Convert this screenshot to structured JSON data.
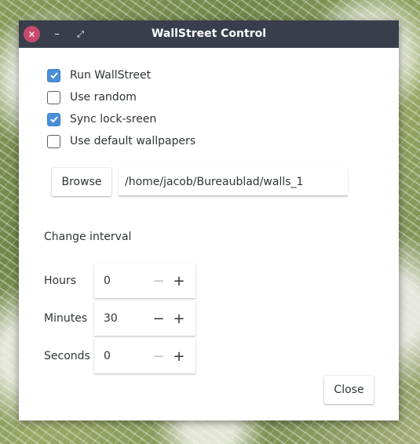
{
  "window": {
    "title": "WallStreet Control",
    "controls": {
      "close_glyph": "✕",
      "minimize_glyph": "–",
      "maximize_glyph": "⤢"
    }
  },
  "options": [
    {
      "label": "Run WallStreet",
      "checked": true
    },
    {
      "label": "Use random",
      "checked": false
    },
    {
      "label": "Sync lock-sreen",
      "checked": true
    },
    {
      "label": "Use default wallpapers",
      "checked": false
    }
  ],
  "browse": {
    "button_label": "Browse",
    "path_value": "/home/jacob/Bureaublad/walls_1"
  },
  "interval": {
    "section_label": "Change interval",
    "hours": {
      "label": "Hours",
      "value": "0",
      "minus_enabled": false
    },
    "minutes": {
      "label": "Minutes",
      "value": "30",
      "minus_enabled": true
    },
    "seconds": {
      "label": "Seconds",
      "value": "0",
      "minus_enabled": false
    }
  },
  "footer": {
    "close_label": "Close"
  },
  "colors": {
    "titlebar": "#3a3e4c",
    "close_button": "#c74a6c",
    "checkbox_checked": "#4a90d9"
  }
}
